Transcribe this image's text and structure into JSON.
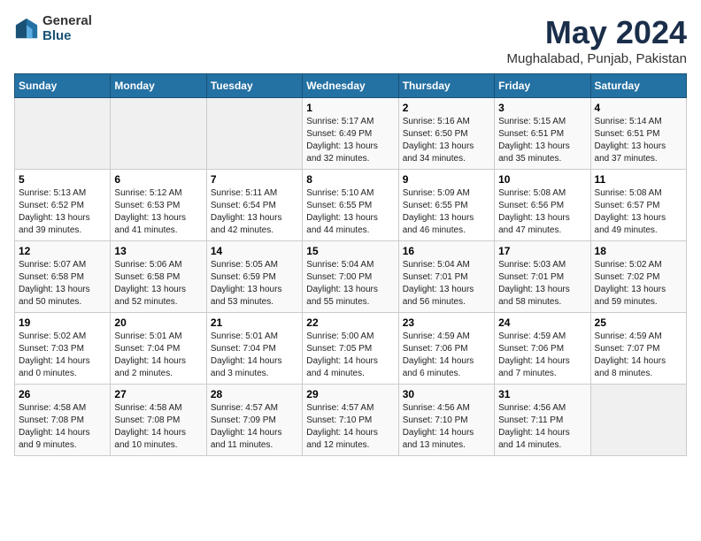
{
  "logo": {
    "general": "General",
    "blue": "Blue"
  },
  "title": "May 2024",
  "subtitle": "Mughalabad, Punjab, Pakistan",
  "days_header": [
    "Sunday",
    "Monday",
    "Tuesday",
    "Wednesday",
    "Thursday",
    "Friday",
    "Saturday"
  ],
  "weeks": [
    [
      {
        "day": "",
        "info": ""
      },
      {
        "day": "",
        "info": ""
      },
      {
        "day": "",
        "info": ""
      },
      {
        "day": "1",
        "info": "Sunrise: 5:17 AM\nSunset: 6:49 PM\nDaylight: 13 hours\nand 32 minutes."
      },
      {
        "day": "2",
        "info": "Sunrise: 5:16 AM\nSunset: 6:50 PM\nDaylight: 13 hours\nand 34 minutes."
      },
      {
        "day": "3",
        "info": "Sunrise: 5:15 AM\nSunset: 6:51 PM\nDaylight: 13 hours\nand 35 minutes."
      },
      {
        "day": "4",
        "info": "Sunrise: 5:14 AM\nSunset: 6:51 PM\nDaylight: 13 hours\nand 37 minutes."
      }
    ],
    [
      {
        "day": "5",
        "info": "Sunrise: 5:13 AM\nSunset: 6:52 PM\nDaylight: 13 hours\nand 39 minutes."
      },
      {
        "day": "6",
        "info": "Sunrise: 5:12 AM\nSunset: 6:53 PM\nDaylight: 13 hours\nand 41 minutes."
      },
      {
        "day": "7",
        "info": "Sunrise: 5:11 AM\nSunset: 6:54 PM\nDaylight: 13 hours\nand 42 minutes."
      },
      {
        "day": "8",
        "info": "Sunrise: 5:10 AM\nSunset: 6:55 PM\nDaylight: 13 hours\nand 44 minutes."
      },
      {
        "day": "9",
        "info": "Sunrise: 5:09 AM\nSunset: 6:55 PM\nDaylight: 13 hours\nand 46 minutes."
      },
      {
        "day": "10",
        "info": "Sunrise: 5:08 AM\nSunset: 6:56 PM\nDaylight: 13 hours\nand 47 minutes."
      },
      {
        "day": "11",
        "info": "Sunrise: 5:08 AM\nSunset: 6:57 PM\nDaylight: 13 hours\nand 49 minutes."
      }
    ],
    [
      {
        "day": "12",
        "info": "Sunrise: 5:07 AM\nSunset: 6:58 PM\nDaylight: 13 hours\nand 50 minutes."
      },
      {
        "day": "13",
        "info": "Sunrise: 5:06 AM\nSunset: 6:58 PM\nDaylight: 13 hours\nand 52 minutes."
      },
      {
        "day": "14",
        "info": "Sunrise: 5:05 AM\nSunset: 6:59 PM\nDaylight: 13 hours\nand 53 minutes."
      },
      {
        "day": "15",
        "info": "Sunrise: 5:04 AM\nSunset: 7:00 PM\nDaylight: 13 hours\nand 55 minutes."
      },
      {
        "day": "16",
        "info": "Sunrise: 5:04 AM\nSunset: 7:01 PM\nDaylight: 13 hours\nand 56 minutes."
      },
      {
        "day": "17",
        "info": "Sunrise: 5:03 AM\nSunset: 7:01 PM\nDaylight: 13 hours\nand 58 minutes."
      },
      {
        "day": "18",
        "info": "Sunrise: 5:02 AM\nSunset: 7:02 PM\nDaylight: 13 hours\nand 59 minutes."
      }
    ],
    [
      {
        "day": "19",
        "info": "Sunrise: 5:02 AM\nSunset: 7:03 PM\nDaylight: 14 hours\nand 0 minutes."
      },
      {
        "day": "20",
        "info": "Sunrise: 5:01 AM\nSunset: 7:04 PM\nDaylight: 14 hours\nand 2 minutes."
      },
      {
        "day": "21",
        "info": "Sunrise: 5:01 AM\nSunset: 7:04 PM\nDaylight: 14 hours\nand 3 minutes."
      },
      {
        "day": "22",
        "info": "Sunrise: 5:00 AM\nSunset: 7:05 PM\nDaylight: 14 hours\nand 4 minutes."
      },
      {
        "day": "23",
        "info": "Sunrise: 4:59 AM\nSunset: 7:06 PM\nDaylight: 14 hours\nand 6 minutes."
      },
      {
        "day": "24",
        "info": "Sunrise: 4:59 AM\nSunset: 7:06 PM\nDaylight: 14 hours\nand 7 minutes."
      },
      {
        "day": "25",
        "info": "Sunrise: 4:59 AM\nSunset: 7:07 PM\nDaylight: 14 hours\nand 8 minutes."
      }
    ],
    [
      {
        "day": "26",
        "info": "Sunrise: 4:58 AM\nSunset: 7:08 PM\nDaylight: 14 hours\nand 9 minutes."
      },
      {
        "day": "27",
        "info": "Sunrise: 4:58 AM\nSunset: 7:08 PM\nDaylight: 14 hours\nand 10 minutes."
      },
      {
        "day": "28",
        "info": "Sunrise: 4:57 AM\nSunset: 7:09 PM\nDaylight: 14 hours\nand 11 minutes."
      },
      {
        "day": "29",
        "info": "Sunrise: 4:57 AM\nSunset: 7:10 PM\nDaylight: 14 hours\nand 12 minutes."
      },
      {
        "day": "30",
        "info": "Sunrise: 4:56 AM\nSunset: 7:10 PM\nDaylight: 14 hours\nand 13 minutes."
      },
      {
        "day": "31",
        "info": "Sunrise: 4:56 AM\nSunset: 7:11 PM\nDaylight: 14 hours\nand 14 minutes."
      },
      {
        "day": "",
        "info": ""
      }
    ]
  ]
}
